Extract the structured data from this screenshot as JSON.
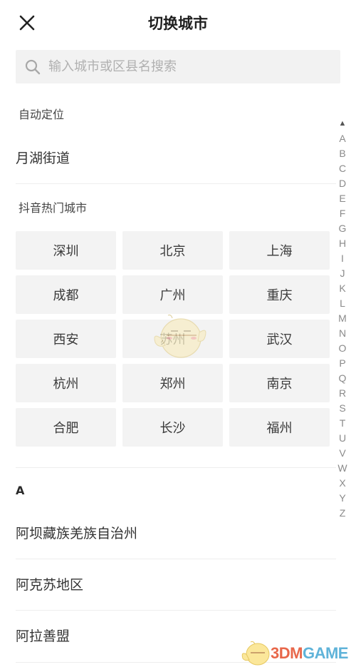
{
  "header": {
    "close_icon": "close-icon",
    "title": "切换城市"
  },
  "search": {
    "icon": "search-icon",
    "placeholder": "输入城市或区县名搜索",
    "value": ""
  },
  "auto_location": {
    "label": "自动定位",
    "city": "月湖街道"
  },
  "hot_cities": {
    "label": "抖音热门城市",
    "items": [
      "深圳",
      "北京",
      "上海",
      "成都",
      "广州",
      "重庆",
      "西安",
      "苏州",
      "武汉",
      "杭州",
      "郑州",
      "南京",
      "合肥",
      "长沙",
      "福州"
    ]
  },
  "city_list": {
    "sections": [
      {
        "letter": "A",
        "items": [
          "阿坝藏族羌族自治州",
          "阿克苏地区",
          "阿拉善盟"
        ]
      }
    ]
  },
  "index_bar": {
    "top_symbol": "▲",
    "letters": [
      "A",
      "B",
      "C",
      "D",
      "E",
      "F",
      "G",
      "H",
      "I",
      "J",
      "K",
      "L",
      "M",
      "N",
      "O",
      "P",
      "Q",
      "R",
      "S",
      "T",
      "U",
      "V",
      "W",
      "X",
      "Y",
      "Z"
    ]
  },
  "watermark": {
    "logo_part1": "3DM",
    "logo_part2": "GAME",
    "colors": {
      "part1": "#e8674a",
      "part2": "#5fb3d9"
    }
  }
}
